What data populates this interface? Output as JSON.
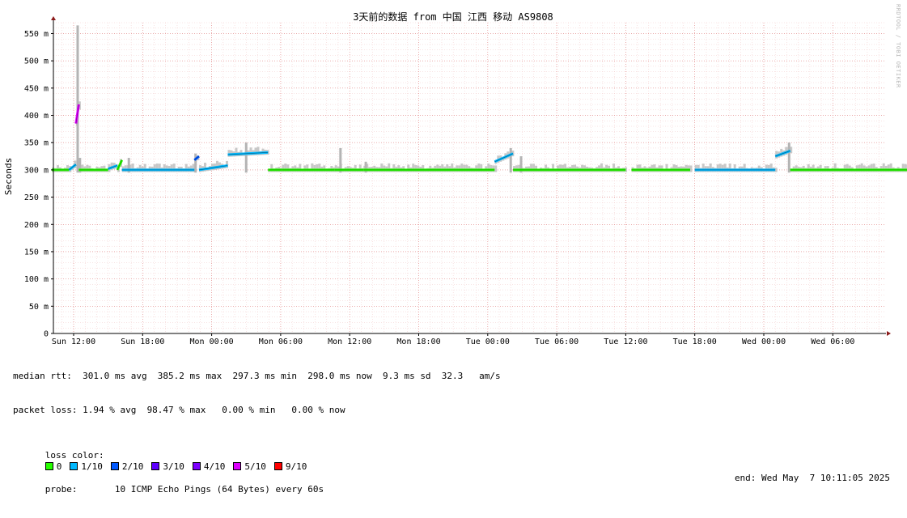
{
  "chart_data": {
    "type": "line",
    "title": "3天前的数据 from 中国 江西 移动 AS9808",
    "ylabel": "Seconds",
    "ylim": [
      0,
      570
    ],
    "y_ticks": [
      "0",
      "50 m",
      "100 m",
      "150 m",
      "200 m",
      "250 m",
      "300 m",
      "350 m",
      "400 m",
      "450 m",
      "500 m",
      "550 m"
    ],
    "x_ticks": [
      "Sun 12:00",
      "Sun 18:00",
      "Mon 00:00",
      "Mon 06:00",
      "Mon 12:00",
      "Mon 18:00",
      "Tue 00:00",
      "Tue 06:00",
      "Tue 12:00",
      "Tue 18:00",
      "Wed 00:00",
      "Wed 06:00"
    ],
    "x_hours": [
      -0.5,
      72.7
    ],
    "x_unit": "hours from Sun 12:00",
    "grid": true,
    "median_segments": [
      {
        "x": [
          -1.9,
          -0.4
        ],
        "y": [
          300,
          300
        ],
        "loss": 0
      },
      {
        "x": [
          -0.4,
          0.2
        ],
        "y": [
          300,
          310
        ],
        "loss": 1
      },
      {
        "x": [
          0.2,
          0.45
        ],
        "y": [
          385,
          420
        ],
        "loss": 5
      },
      {
        "x": [
          0.45,
          3.0
        ],
        "y": [
          300,
          300
        ],
        "loss": 0
      },
      {
        "x": [
          3.0,
          3.8
        ],
        "y": [
          302,
          308
        ],
        "loss": 1
      },
      {
        "x": [
          3.8,
          4.2
        ],
        "y": [
          300,
          318
        ],
        "loss": 0
      },
      {
        "x": [
          4.2,
          10.5
        ],
        "y": [
          300,
          300
        ],
        "loss": 1
      },
      {
        "x": [
          10.5,
          10.9
        ],
        "y": [
          318,
          325
        ],
        "loss": 2
      },
      {
        "x": [
          10.9,
          13.4
        ],
        "y": [
          300,
          308
        ],
        "loss": 1
      },
      {
        "x": [
          13.4,
          16.9
        ],
        "y": [
          328,
          332
        ],
        "loss": 1
      },
      {
        "x": [
          16.9,
          18.1
        ],
        "y": [
          300,
          300
        ],
        "loss": 0
      },
      {
        "x": [
          18.1,
          22.7
        ],
        "y": [
          300,
          300
        ],
        "loss": 0
      },
      {
        "x": [
          22.7,
          25.2
        ],
        "y": [
          300,
          300
        ],
        "loss": 0
      },
      {
        "x": [
          25.2,
          36.6
        ],
        "y": [
          300,
          300
        ],
        "loss": 0
      },
      {
        "x": [
          36.6,
          38.2
        ],
        "y": [
          315,
          330
        ],
        "loss": 1
      },
      {
        "x": [
          38.2,
          48.0
        ],
        "y": [
          300,
          300
        ],
        "loss": 0
      },
      {
        "x": [
          48.5,
          53.6
        ],
        "y": [
          300,
          300
        ],
        "loss": 0
      },
      {
        "x": [
          54.0,
          61.0
        ],
        "y": [
          300,
          300
        ],
        "loss": 1
      },
      {
        "x": [
          61.0,
          62.3
        ],
        "y": [
          325,
          335
        ],
        "loss": 1
      },
      {
        "x": [
          62.3,
          72.7
        ],
        "y": [
          300,
          300
        ],
        "loss": 0
      }
    ],
    "smoke_spikes": [
      {
        "x": 0.35,
        "y": 565
      },
      {
        "x": 0.55,
        "y": 322
      },
      {
        "x": 4.8,
        "y": 322
      },
      {
        "x": 10.6,
        "y": 330
      },
      {
        "x": 15.0,
        "y": 350
      },
      {
        "x": 23.2,
        "y": 340
      },
      {
        "x": 25.4,
        "y": 315
      },
      {
        "x": 38.0,
        "y": 340
      },
      {
        "x": 38.9,
        "y": 325
      },
      {
        "x": 62.2,
        "y": 350
      }
    ],
    "loss_colors": {
      "0": "#26ff00",
      "1/10": "#00b8ff",
      "2/10": "#0059ff",
      "3/10": "#5e00ff",
      "4/10": "#7e00ff",
      "5/10": "#dd00ff",
      "9/10": "#ff0000"
    }
  },
  "legend": {
    "median_rtt": "median rtt:  301.0 ms avg  385.2 ms max  297.3 ms min  298.0 ms now  9.3 ms sd  32.3   am/s",
    "packet_loss": "packet loss: 1.94 % avg  98.47 % max   0.00 % min   0.00 % now",
    "loss_color_label": "loss color: ",
    "loss_items": [
      {
        "label": "0",
        "color": "#26ff00"
      },
      {
        "label": "1/10",
        "color": "#00b8ff"
      },
      {
        "label": "2/10",
        "color": "#0059ff"
      },
      {
        "label": "3/10",
        "color": "#5e00ff"
      },
      {
        "label": "4/10",
        "color": "#7e00ff"
      },
      {
        "label": "5/10",
        "color": "#dd00ff"
      },
      {
        "label": "9/10",
        "color": "#ff0000"
      }
    ],
    "probe": "probe:       10 ICMP Echo Pings (64 Bytes) every 60s",
    "end": "end: Wed May  7 10:11:05 2025"
  },
  "watermark": "RRDTOOL / TOBI OETIKER"
}
